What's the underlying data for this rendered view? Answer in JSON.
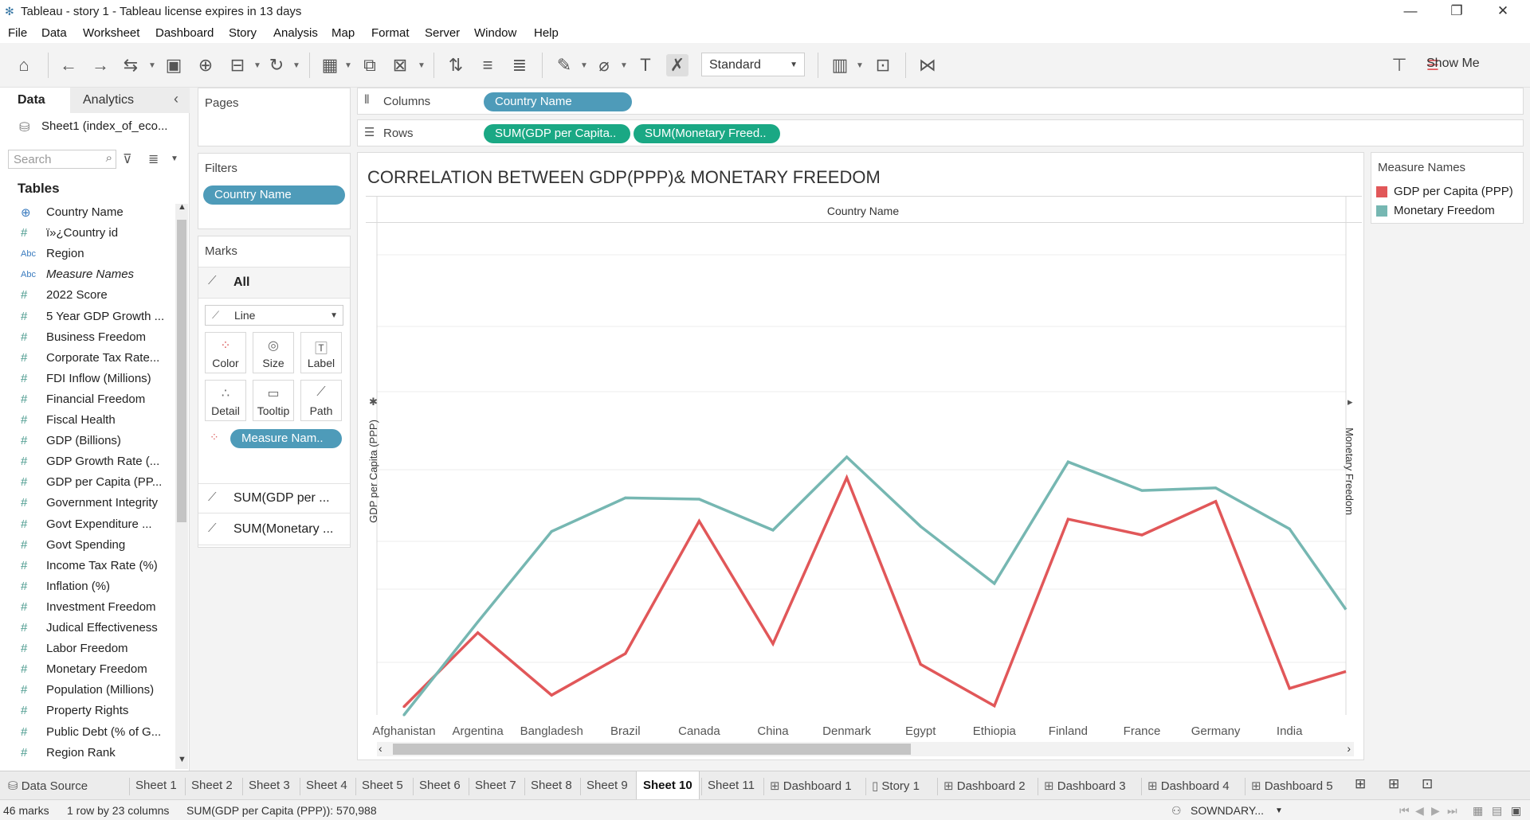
{
  "window": {
    "title": "Tableau - story 1 - Tableau license expires in 13 days",
    "minimize": "—",
    "restore": "❐",
    "close": "✕"
  },
  "menu": [
    "File",
    "Data",
    "Worksheet",
    "Dashboard",
    "Story",
    "Analysis",
    "Map",
    "Format",
    "Server",
    "Window",
    "Help"
  ],
  "toolbar": {
    "fit_value": "Standard",
    "show_me_label": "Show Me"
  },
  "data_pane": {
    "tab_data": "Data",
    "tab_analytics": "Analytics",
    "source": "Sheet1 (index_of_eco...",
    "search_placeholder": "Search",
    "tables_header": "Tables",
    "fields": [
      {
        "name": "Country Name",
        "type": "geo"
      },
      {
        "name": "ï»¿Country id",
        "type": "num"
      },
      {
        "name": "Region",
        "type": "abc"
      },
      {
        "name": "Measure Names",
        "type": "abc"
      },
      {
        "name": "2022 Score",
        "type": "num"
      },
      {
        "name": "5 Year GDP Growth ...",
        "type": "num"
      },
      {
        "name": "Business Freedom",
        "type": "num"
      },
      {
        "name": "Corporate Tax Rate...",
        "type": "num"
      },
      {
        "name": "FDI Inflow (Millions)",
        "type": "num"
      },
      {
        "name": "Financial Freedom",
        "type": "num"
      },
      {
        "name": "Fiscal Health",
        "type": "num"
      },
      {
        "name": "GDP (Billions)",
        "type": "num"
      },
      {
        "name": "GDP Growth Rate (...",
        "type": "num"
      },
      {
        "name": "GDP per Capita (PP...",
        "type": "num"
      },
      {
        "name": "Government Integrity",
        "type": "num"
      },
      {
        "name": "Govt Expenditure ...",
        "type": "num"
      },
      {
        "name": "Govt Spending",
        "type": "num"
      },
      {
        "name": "Income Tax Rate (%)",
        "type": "num"
      },
      {
        "name": "Inflation (%)",
        "type": "num"
      },
      {
        "name": "Investment Freedom",
        "type": "num"
      },
      {
        "name": "Judical Effectiveness",
        "type": "num"
      },
      {
        "name": "Labor Freedom",
        "type": "num"
      },
      {
        "name": "Monetary Freedom",
        "type": "num"
      },
      {
        "name": "Population (Millions)",
        "type": "num"
      },
      {
        "name": "Property Rights",
        "type": "num"
      },
      {
        "name": "Public Debt (% of G...",
        "type": "num"
      },
      {
        "name": "Region Rank",
        "type": "num"
      }
    ]
  },
  "pages": {
    "header": "Pages"
  },
  "filters": {
    "header": "Filters",
    "pill": "Country Name"
  },
  "marks": {
    "header": "Marks",
    "all_label": "All",
    "mark_type": "Line",
    "buttons": [
      {
        "label": "Color",
        "icon": "color-icon"
      },
      {
        "label": "Size",
        "icon": "size-icon"
      },
      {
        "label": "Label",
        "icon": "label-icon"
      },
      {
        "label": "Detail",
        "icon": "detail-icon"
      },
      {
        "label": "Tooltip",
        "icon": "tooltip-icon"
      },
      {
        "label": "Path",
        "icon": "path-icon"
      }
    ],
    "color_pill": "Measure Nam..",
    "measure_cards": [
      "SUM(GDP per ...",
      "SUM(Monetary ..."
    ]
  },
  "shelves": {
    "columns_label": "Columns",
    "rows_label": "Rows",
    "columns_pill": "Country Name",
    "rows_pills": [
      "SUM(GDP per Capita..",
      "SUM(Monetary Freed.."
    ]
  },
  "view": {
    "title": "CORRELATION BETWEEN GDP(PPP)& MONETARY FREEDOM",
    "header": "Country Name",
    "left_axis_label": "GDP per Capita (PPP)",
    "right_axis_label": "Monetary Freedom"
  },
  "legend": {
    "title": "Measure Names",
    "items": [
      {
        "label": "GDP per Capita (PPP)",
        "color": "#e15759"
      },
      {
        "label": "Monetary Freedom",
        "color": "#76b7b2"
      }
    ]
  },
  "chart_data": {
    "type": "line",
    "categories": [
      "Afghanistan",
      "Argentina",
      "Bangladesh",
      "Brazil",
      "Canada",
      "China",
      "Denmark",
      "Egypt",
      "Ethiopia",
      "Finland",
      "France",
      "Germany",
      "India"
    ],
    "series": [
      {
        "name": "GDP per Capita (PPP)",
        "color": "#e15759",
        "values": [
          2100,
          20800,
          5000,
          15500,
          49000,
          18000,
          60000,
          12800,
          2300,
          49500,
          45500,
          54000,
          6700
        ]
      },
      {
        "name": "Monetary Freedom",
        "color": "#76b7b2",
        "values": [
          58.0,
          65.5,
          72.8,
          75.5,
          75.4,
          72.9,
          78.8,
          73.2,
          68.6,
          78.4,
          76.1,
          76.3,
          73.0
        ]
      }
    ],
    "trailing_values": {
      "GDP per Capita (PPP)": 11000,
      "Monetary Freedom": 66.5
    },
    "ylim_left": [
      0,
      60000
    ],
    "ylim_right": [
      58,
      78.8
    ],
    "grid": true
  },
  "sheet_tabs": [
    {
      "label": "Data Source",
      "icon": "database-icon"
    },
    {
      "label": "Sheet 1"
    },
    {
      "label": "Sheet 2"
    },
    {
      "label": "Sheet 3"
    },
    {
      "label": "Sheet 4"
    },
    {
      "label": "Sheet 5"
    },
    {
      "label": "Sheet 6"
    },
    {
      "label": "Sheet 7"
    },
    {
      "label": "Sheet 8"
    },
    {
      "label": "Sheet 9"
    },
    {
      "label": "Sheet 10",
      "active": true
    },
    {
      "label": "Sheet 11"
    },
    {
      "label": "Dashboard 1",
      "icon": "dashboard-icon"
    },
    {
      "label": "Story 1",
      "icon": "story-icon"
    },
    {
      "label": "Dashboard 2",
      "icon": "dashboard-icon"
    },
    {
      "label": "Dashboard 3",
      "icon": "dashboard-icon"
    },
    {
      "label": "Dashboard 4",
      "icon": "dashboard-icon"
    },
    {
      "label": "Dashboard 5",
      "icon": "dashboard-icon"
    }
  ],
  "status": {
    "marks": "46 marks",
    "dims": "1 row by 23 columns",
    "sum": "SUM(GDP per Capita (PPP)): 570,988",
    "user": "SOWNDARY..."
  }
}
